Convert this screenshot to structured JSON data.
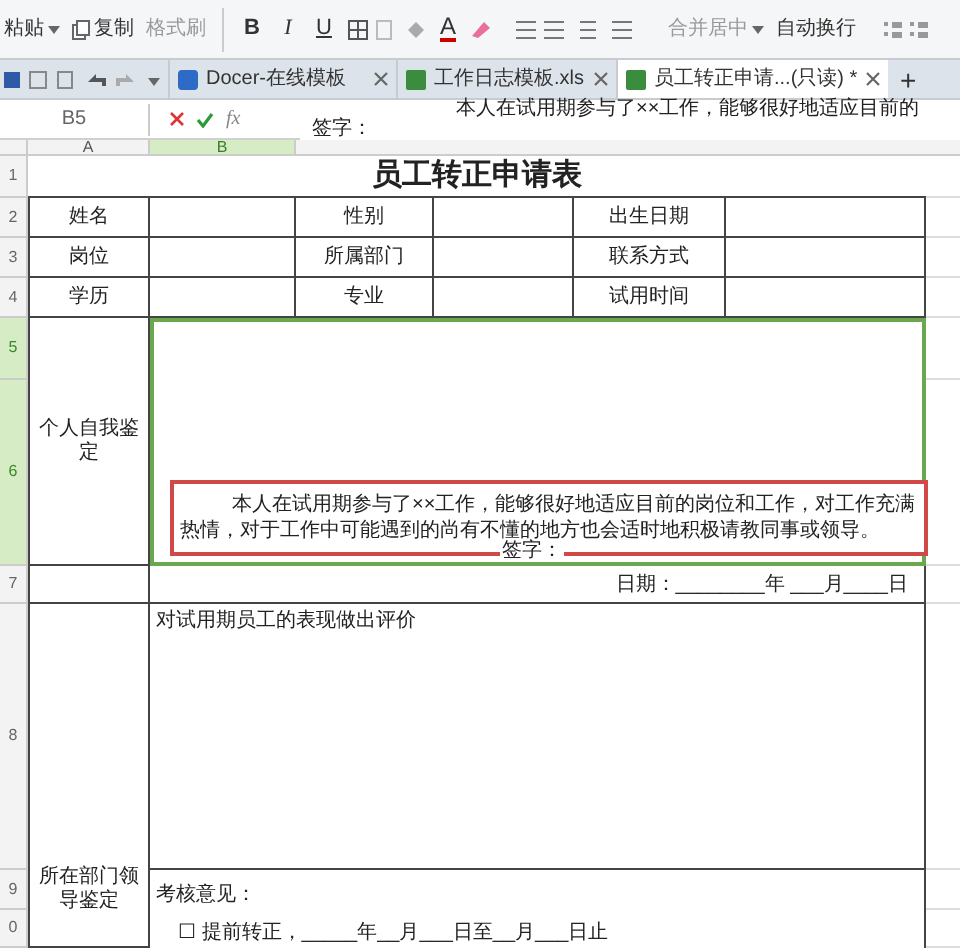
{
  "toolbar": {
    "paste": "粘贴",
    "copy": "复制",
    "format_painter": "格式刷",
    "bold": "B",
    "italic": "I",
    "underline": "U",
    "font_color": "A",
    "merge": "合并居中",
    "wrap": "自动换行"
  },
  "tabs": [
    {
      "kind": "docer",
      "label": "Docer-在线模板",
      "selected": false
    },
    {
      "kind": "sheet",
      "label": "工作日志模板.xls",
      "selected": false
    },
    {
      "kind": "sheet",
      "label": "员工转正申请...(只读) *",
      "selected": true
    }
  ],
  "new_tab": "+",
  "formula_bar": {
    "cell_ref": "B5",
    "function_label": "fx",
    "formula_lines": [
      "本人在试用期参与了××工作，能够很好地适应目前的",
      "签字："
    ]
  },
  "column_headers": [
    {
      "label": "A",
      "selected": false
    },
    {
      "label": "B",
      "selected": true
    }
  ],
  "row_headers": [
    {
      "label": "1",
      "selected": false
    },
    {
      "label": "2",
      "selected": false
    },
    {
      "label": "3",
      "selected": false
    },
    {
      "label": "4",
      "selected": false
    },
    {
      "label": "5",
      "selected": true
    },
    {
      "label": "6",
      "selected": true
    },
    {
      "label": "7",
      "selected": false
    },
    {
      "label": "8",
      "selected": false
    },
    {
      "label": "9",
      "selected": false
    },
    {
      "label": "0",
      "selected": false
    }
  ],
  "sheet": {
    "title": "员工转正申请表",
    "info_rows": [
      [
        "姓名",
        "性别",
        "出生日期"
      ],
      [
        "岗位",
        "所属部门",
        "联系方式"
      ],
      [
        "学历",
        "专业",
        "试用时间"
      ]
    ],
    "self_eval_label": "个人自我鉴定",
    "self_eval_text": "本人在试用期参与了××工作，能够很好地适应目前的岗位和工作，对工作充满热情，对于工作中可能遇到的尚有不懂的地方也会适时地积极请教同事或领导。",
    "signature": "签字：",
    "date_line": "日期：________年 ___月____日",
    "leader_label": "所在部门领导鉴定",
    "evaluation_prompt": "对试用期员工的表现做出评价",
    "opinion_label": "考核意见：",
    "option_line": "☐ 提前转正，_____年__月___日至__月___日止"
  }
}
